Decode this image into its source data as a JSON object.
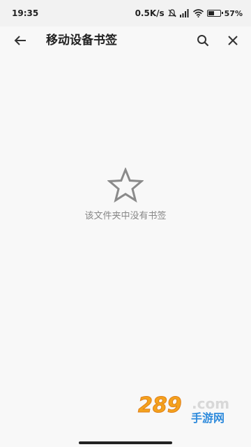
{
  "status_bar": {
    "time": "19:35",
    "net_speed": "0.5K/s",
    "battery_percent": "57%",
    "battery_level": 0.57
  },
  "toolbar": {
    "title": "移动设备书签"
  },
  "empty_state": {
    "message": "该文件夹中没有书签"
  },
  "watermark": {
    "digits": "289",
    "suffix": ".com",
    "site": "手游网"
  },
  "colors": {
    "background": "#f8f8f8",
    "text_primary": "#222222",
    "text_secondary": "#888888",
    "watermark_orange": "#f4a21d",
    "watermark_blue": "#2f8bdc"
  },
  "icons": [
    "back-arrow-icon",
    "search-icon",
    "close-icon",
    "star-outline-icon",
    "mute-icon",
    "signal-icon",
    "wifi-icon",
    "battery-icon"
  ]
}
